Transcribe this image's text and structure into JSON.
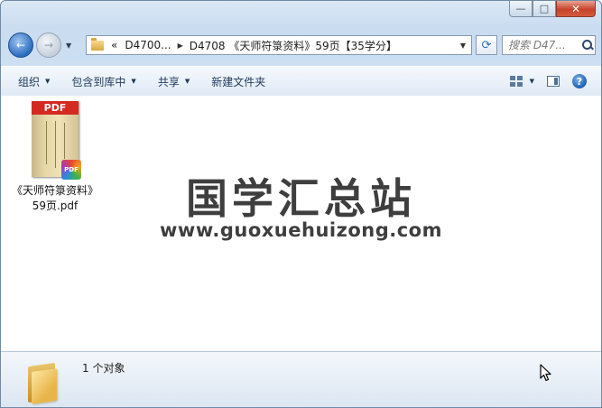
{
  "window": {
    "caption_buttons": {
      "minimize": "—",
      "maximize": "□",
      "close": "✕"
    },
    "colors": {
      "close": "#c7432b",
      "chrome": "#c9dcf0",
      "accent": "#2c6cbf"
    }
  },
  "navigation": {
    "back_glyph": "←",
    "forward_glyph": "→",
    "history_chevron": "▼",
    "refresh_glyph": "⟳"
  },
  "address": {
    "overflow": "«",
    "crumbs": [
      "D4700...",
      "D4708 《天师符箓资料》59页【35学分】"
    ],
    "separator": "▶",
    "dropdown": "▼"
  },
  "search": {
    "placeholder": "搜索 D47..."
  },
  "toolbar": {
    "items": [
      {
        "label": "组织",
        "has_menu": true
      },
      {
        "label": "包含到库中",
        "has_menu": true
      },
      {
        "label": "共享",
        "has_menu": true
      },
      {
        "label": "新建文件夹",
        "has_menu": false
      }
    ],
    "menu_glyph": "▼",
    "help_glyph": "?"
  },
  "files": [
    {
      "name": "《天师符箓资料》59页.pdf",
      "type_label": "PDF",
      "icon": "pdf-file-icon"
    }
  ],
  "watermark": {
    "title": "国学汇总站",
    "url": "www.guoxuehuizong.com"
  },
  "details": {
    "count": "1 个对象"
  }
}
